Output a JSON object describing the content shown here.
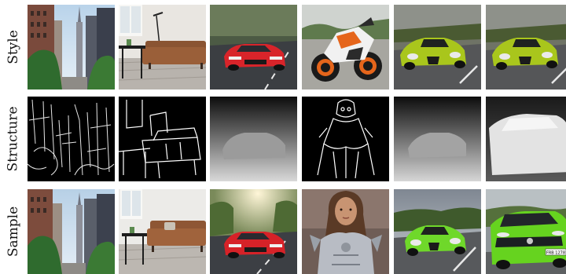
{
  "figure": {
    "row_labels": {
      "style": "Style",
      "structure": "Structure",
      "sample": "Sample"
    },
    "rows": [
      {
        "key": "style",
        "cells": [
          "city-street-photo",
          "living-room-sofa-photo",
          "red-sports-car-photo",
          "ktm-motorcycle-photo",
          "lime-green-roadster-photo",
          "lime-green-roadster-photo"
        ]
      },
      {
        "key": "structure",
        "cells": [
          "city-edge-map",
          "room-edge-map",
          "car-depth-map",
          "knight-edge-sketch",
          "car-depth-map",
          "suv-depth-map"
        ]
      },
      {
        "key": "sample",
        "cells": [
          "city-street-sample",
          "living-room-sample",
          "red-car-sample",
          "armored-woman-sample",
          "green-roadster-sample",
          "green-suv-sample"
        ]
      }
    ],
    "plate_text": "FRB 1278"
  }
}
